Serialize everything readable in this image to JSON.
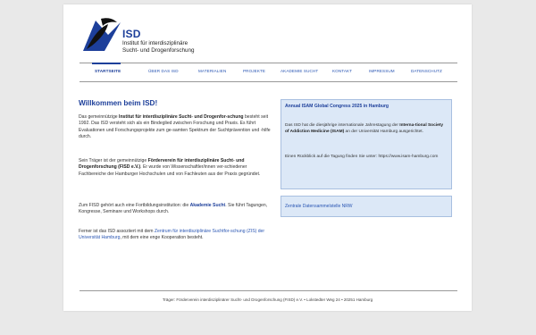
{
  "logo": {
    "abbr": "ISD",
    "line1": "Institut für interdisziplinäre",
    "line2": "Sucht- und Drogenforschung",
    "colors": {
      "blue": "#1d3f9a",
      "black": "#111111"
    }
  },
  "nav": {
    "items": [
      {
        "label": "STARTSEITE",
        "active": true
      },
      {
        "label": "ÜBER DAS ISD"
      },
      {
        "label": "MATERIALIEN"
      },
      {
        "label": "PROJEKTE"
      },
      {
        "label": "AKADEMIE SUCHT"
      },
      {
        "label": "KONTAKT"
      },
      {
        "label": "IMPRESSUM"
      },
      {
        "label": "DATENSCHUTZ"
      }
    ]
  },
  "main": {
    "heading": "Willkommen beim ISD!",
    "p1": {
      "a": "Das gemeinnützige ",
      "b": "Institut für interdisziplinäre Sucht- und Drogenfor-schung",
      "c": " besteht seit 1992. Das ISD versteht sich als ein Bindeglied zwischen Forschung und Praxis. Es führt Evaluationen und Forschungsprojekte zum ge-samten Spektrum der Suchtprävention und -hilfe durch."
    },
    "p2": {
      "a": "Sein Träger ist der gemeinnützige ",
      "b": "Förderverein für interdisziplinäre Sucht- und Drogenforschung (FISD e.V.)",
      "c": ". Er wurde von Wissenschaftler/innen ver-schiedener Fachbereiche der Hamburger Hochschulen und von Fachleuten aus der Praxis gegründet."
    },
    "p3": {
      "a": "Zum FISD gehört auch eine Fortbildungsinstitution: die ",
      "b": "Akademie Sucht",
      "c": ". Sie führt Tagungen, Kongresse, Seminare und Workshops durch."
    },
    "p4": {
      "a": "Ferner ist das ISD assoziiert mit dem ",
      "link1": "Zentrum für interdisziplinäre Suchtfor-schung (ZIS) der Universität Hamburg",
      "c": ", mit dem eine enge Kooperation besteht."
    }
  },
  "sidebar": {
    "box1": {
      "title": "Annual ISAM Global Congress 2025 in Hamburg",
      "t1a": "Das ISD hat die diesjährige internationale Jahrestagung der ",
      "t1b": "Interna-tional Society of Addiction Medicine (ISAM)",
      "t1c": " an der Universität Hamburg ausgerichtet.",
      "t2": "Einen Rückblick auf die Tagung finden Sie unter: https://www.isam-hamburg.com"
    },
    "box2": {
      "link": "Zentrale Datensammelstelle NRW"
    }
  },
  "footer": {
    "text": "Träger: Förderverein interdisziplinärer Sucht- und Drogenforschung (FISD) e.V. • Lokstedter Weg 24 • 20251 Hamburg"
  }
}
